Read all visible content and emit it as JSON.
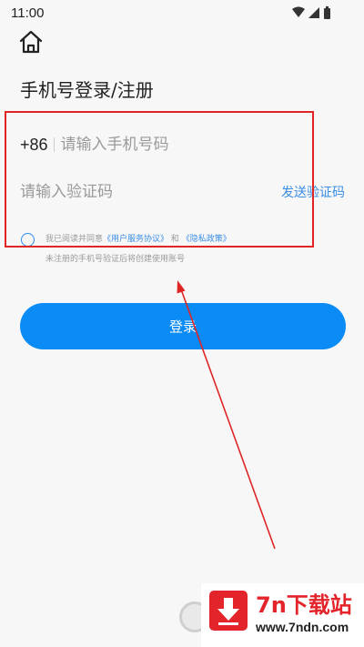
{
  "status_bar": {
    "time": "11:00",
    "icons": [
      "wifi-icon",
      "signal-icon",
      "battery-icon"
    ]
  },
  "header": {
    "title": "手机号登录/注册",
    "home_icon": "home-icon"
  },
  "form": {
    "country_code": "+86",
    "phone_placeholder": "请输入手机号码",
    "code_placeholder": "请输入验证码",
    "send_code_label": "发送验证码"
  },
  "agreement": {
    "prefix": "我已阅读并同意",
    "user_agreement": "《用户服务协议》",
    "connector": "和",
    "privacy_policy": "《隐私政策》",
    "note": "未注册的手机号验证后将创建使用账号"
  },
  "login_button": {
    "label": "登录"
  },
  "watermark": {
    "title": "7n下载站",
    "url": "www.7ndn.com"
  },
  "colors": {
    "accent": "#0a8bf5",
    "link": "#3a8ee6",
    "annotation": "#e02525",
    "background": "#f7f7f7"
  }
}
